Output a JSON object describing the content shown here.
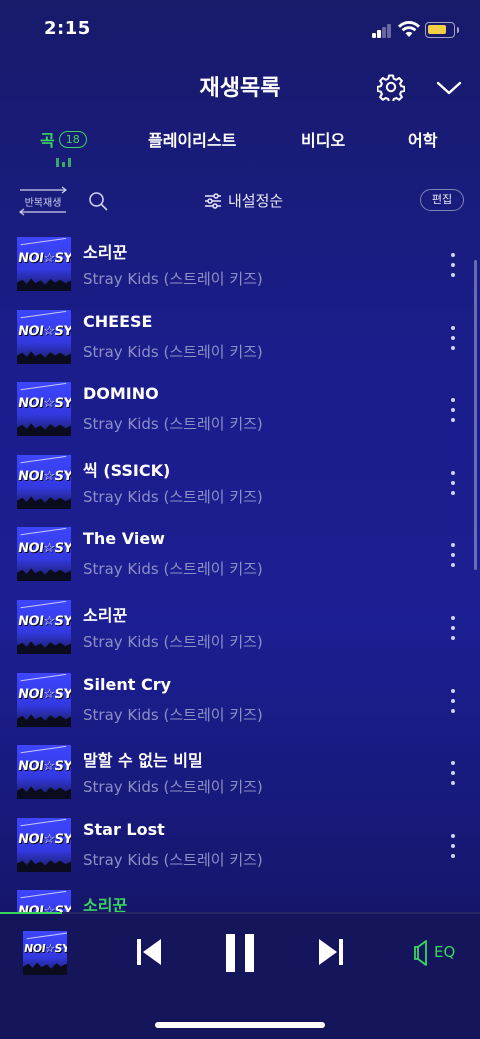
{
  "status_bar": {
    "time": "2:15"
  },
  "header": {
    "title": "재생목록"
  },
  "tabs": [
    {
      "label": "곡",
      "count": "18"
    },
    {
      "label": "플레이리스트"
    },
    {
      "label": "비디오"
    },
    {
      "label": "어학"
    }
  ],
  "toolbar": {
    "repeat_label": "반복재생",
    "sort_label": "내설정순",
    "edit_label": "편집"
  },
  "album": {
    "logo_text": "NOI☆SY"
  },
  "songs": [
    {
      "title": "소리꾼",
      "artist": "Stray Kids (스트레이 키즈)"
    },
    {
      "title": "CHEESE",
      "artist": "Stray Kids (스트레이 키즈)"
    },
    {
      "title": "DOMINO",
      "artist": "Stray Kids (스트레이 키즈)"
    },
    {
      "title": "씩 (SSICK)",
      "artist": "Stray Kids (스트레이 키즈)"
    },
    {
      "title": "The View",
      "artist": "Stray Kids (스트레이 키즈)"
    },
    {
      "title": "소리꾼",
      "artist": "Stray Kids (스트레이 키즈)"
    },
    {
      "title": "Silent Cry",
      "artist": "Stray Kids (스트레이 키즈)"
    },
    {
      "title": "말할 수 없는 비밀",
      "artist": "Stray Kids (스트레이 키즈)"
    },
    {
      "title": "Star Lost",
      "artist": "Stray Kids (스트레이 키즈)"
    },
    {
      "title": "소리꾼",
      "artist": ""
    }
  ],
  "player": {
    "eq_label": "EQ",
    "progress": 0.13
  },
  "colors": {
    "accent": "#39d55f",
    "background": "#1b1d8c",
    "secondary_text": "#8d8fc4"
  }
}
